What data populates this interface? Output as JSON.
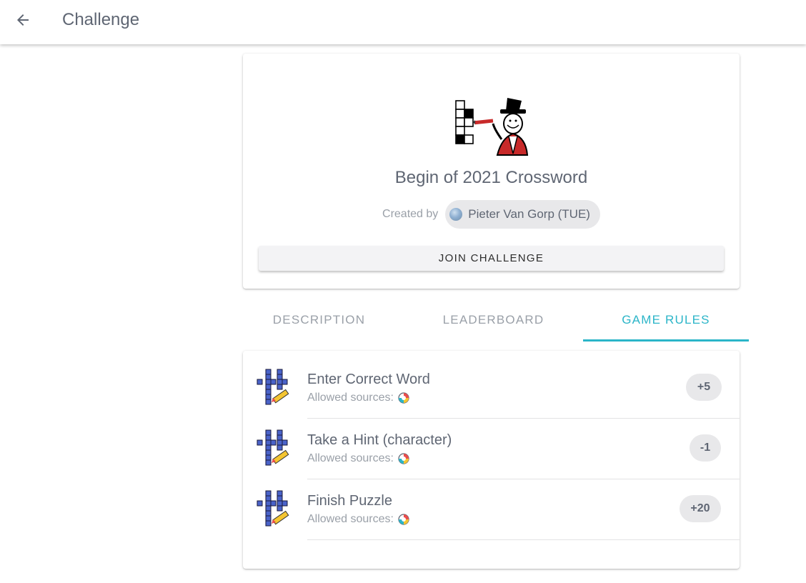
{
  "appbar": {
    "title": "Challenge",
    "back_icon": "arrow-left-icon"
  },
  "challenge": {
    "logo_icon": "crossword-puzzler-icon",
    "title": "Begin of 2021 Crossword",
    "created_by_label": "Created by",
    "creator_name": "Pieter Van Gorp (TUE)",
    "creator_avatar_icon": "user-avatar-icon",
    "join_button_label": "JOIN CHALLENGE"
  },
  "tabs": [
    {
      "label": "DESCRIPTION",
      "active": false
    },
    {
      "label": "LEADERBOARD",
      "active": false
    },
    {
      "label": "GAME RULES",
      "active": true
    }
  ],
  "rules": [
    {
      "name": "Enter Correct Word",
      "sources_label": "Allowed sources:",
      "source_icon": "crossword-app-icon",
      "points": "+5"
    },
    {
      "name": "Take a Hint (character)",
      "sources_label": "Allowed sources:",
      "source_icon": "crossword-app-icon",
      "points": "-1"
    },
    {
      "name": "Finish Puzzle",
      "sources_label": "Allowed sources:",
      "source_icon": "crossword-app-icon",
      "points": "+20"
    }
  ],
  "colors": {
    "accent": "#2bb5c8",
    "text": "#5f6673",
    "muted": "#9aa0a8",
    "chip_bg": "#e8e8ea"
  }
}
